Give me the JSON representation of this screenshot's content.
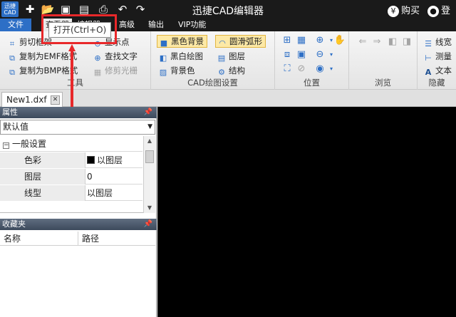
{
  "titlebar": {
    "logo_text": "迅捷CAD",
    "title": "迅捷CAD编辑器",
    "buy_label": "购买",
    "buy_icon": "yen-icon",
    "login_label": "登录",
    "login_icon": "user-icon"
  },
  "menu": {
    "file": "文件",
    "tabs": [
      "查看器",
      "编辑器",
      "高级",
      "输出",
      "VIP功能"
    ]
  },
  "tooltip": "打开(Ctrl+O)",
  "ribbon": {
    "tools": {
      "label": "工具",
      "items": [
        "剪切框架",
        "复制为EMF格式",
        "复制为BMP格式",
        "显示点",
        "查找文字",
        "修剪光栅"
      ]
    },
    "cad": {
      "label": "CAD绘图设置",
      "items": [
        "黑色背景",
        "黑白绘图",
        "背景色",
        "圆滑弧形",
        "图层",
        "结构"
      ]
    },
    "position": {
      "label": "位置"
    },
    "browse": {
      "label": "浏览"
    },
    "hide": {
      "label": "隐藏",
      "items": [
        "线宽",
        "测量",
        "文本"
      ]
    }
  },
  "document": {
    "tab_name": "New1.dxf"
  },
  "properties": {
    "header": "属性",
    "dropdown_value": "默认值",
    "section": "一般设置",
    "rows": [
      {
        "name": "色彩",
        "value": "以图层"
      },
      {
        "name": "图层",
        "value": "0"
      },
      {
        "name": "线型",
        "value": "以图层"
      }
    ]
  },
  "favorites": {
    "header": "收藏夹",
    "columns": [
      "名称",
      "路径"
    ]
  },
  "colors": {
    "accent": "#2d6fc6",
    "titlebar": "#1a1a1a",
    "canvas": "#000000",
    "highlight": "#e8282a"
  }
}
